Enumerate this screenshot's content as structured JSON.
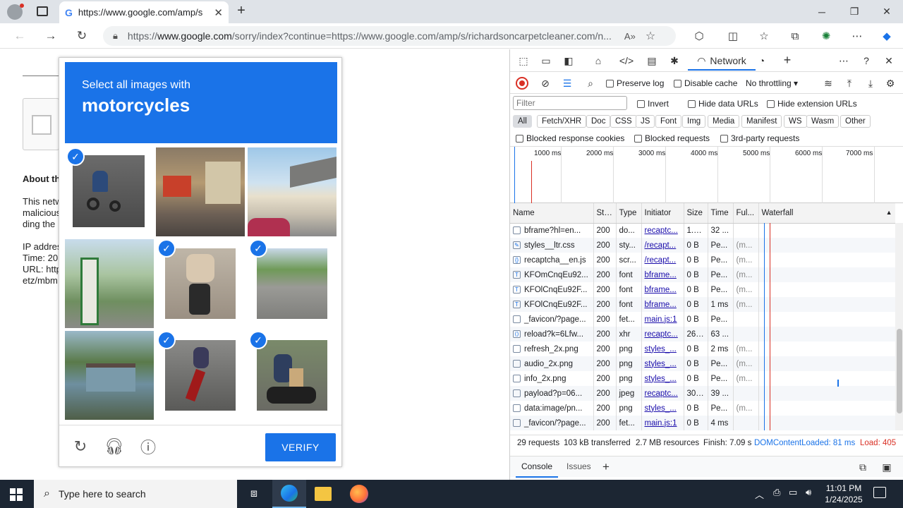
{
  "browser": {
    "tab_title": "https://www.google.com/amp/s",
    "url_prefix": "https://",
    "url_domain": "www.google.com",
    "url_rest": "/sorry/index?continue=https://www.google.com/amp/s/richardsoncarpetcleaner.com/n..."
  },
  "page": {
    "about_heading": "About th",
    "lines": [
      "This netw",
      "malicious",
      "ding the ",
      "",
      "IP addres",
      "Time: 20:",
      "URL: http",
      "etz/mbm"
    ]
  },
  "captcha": {
    "line1": "Select all images with",
    "line2": "motorcycles",
    "verify_label": "VERIFY",
    "check_glyph": "✓",
    "tiles": [
      {
        "selected": true,
        "scene": "motorcycle"
      },
      {
        "selected": false,
        "scene": "street"
      },
      {
        "selected": false,
        "scene": "overpass"
      },
      {
        "selected": false,
        "scene": "monument"
      },
      {
        "selected": true,
        "scene": "motorcycle"
      },
      {
        "selected": true,
        "scene": "road"
      },
      {
        "selected": false,
        "scene": "house"
      },
      {
        "selected": true,
        "scene": "motorcycle"
      },
      {
        "selected": true,
        "scene": "motorcycle"
      }
    ]
  },
  "devtools": {
    "tabs": {
      "network": "Network"
    },
    "preserve_log": "Preserve log",
    "disable_cache": "Disable cache",
    "throttling": "No throttling",
    "filter_placeholder": "Filter",
    "invert": "Invert",
    "hide_data_urls": "Hide data URLs",
    "hide_extension_urls": "Hide extension URLs",
    "type_filters": [
      "All",
      "Fetch/XHR",
      "Doc",
      "CSS",
      "JS",
      "Font",
      "Img",
      "Media",
      "Manifest",
      "WS",
      "Wasm",
      "Other"
    ],
    "blocked_response_cookies": "Blocked response cookies",
    "blocked_requests": "Blocked requests",
    "third_party": "3rd-party requests",
    "timeline_ticks": [
      "1000 ms",
      "2000 ms",
      "3000 ms",
      "4000 ms",
      "5000 ms",
      "6000 ms",
      "7000 ms"
    ],
    "columns": [
      "Name",
      "Sta...",
      "Type",
      "Initiator",
      "Size",
      "Time",
      "Ful...",
      "Waterfall"
    ],
    "rows": [
      [
        "bframe?hl=en...",
        "200",
        "do...",
        "recaptc...",
        "1.3...",
        "32 ...",
        ""
      ],
      [
        "styles__ltr.css",
        "200",
        "sty...",
        "/recapt...",
        "0 B",
        "Pe...",
        "(m..."
      ],
      [
        "recaptcha__en.js",
        "200",
        "scr...",
        "/recapt...",
        "0 B",
        "Pe...",
        "(m..."
      ],
      [
        "KFOmCnqEu92...",
        "200",
        "font",
        "bframe...",
        "0 B",
        "Pe...",
        "(m..."
      ],
      [
        "KFOlCnqEu92F...",
        "200",
        "font",
        "bframe...",
        "0 B",
        "Pe...",
        "(m..."
      ],
      [
        "KFOlCnqEu92F...",
        "200",
        "font",
        "bframe...",
        "0 B",
        "1 ms",
        "(m..."
      ],
      [
        "_favicon/?page...",
        "200",
        "fet...",
        "main.js:1",
        "0 B",
        "Pe...",
        ""
      ],
      [
        "reload?k=6Lfw...",
        "200",
        "xhr",
        "recaptc...",
        "26....",
        "63 ...",
        ""
      ],
      [
        "refresh_2x.png",
        "200",
        "png",
        "styles_...",
        "0 B",
        "2 ms",
        "(m..."
      ],
      [
        "audio_2x.png",
        "200",
        "png",
        "styles_...",
        "0 B",
        "Pe...",
        "(m..."
      ],
      [
        "info_2x.png",
        "200",
        "png",
        "styles_...",
        "0 B",
        "Pe...",
        "(m..."
      ],
      [
        "payload?p=06...",
        "200",
        "jpeg",
        "recaptc...",
        "30....",
        "39 ...",
        ""
      ],
      [
        "data:image/pn...",
        "200",
        "png",
        "styles_...",
        "0 B",
        "Pe...",
        "(m..."
      ],
      [
        "_favicon/?page...",
        "200",
        "fet...",
        "main.js:1",
        "0 B",
        "4 ms",
        ""
      ]
    ],
    "status": {
      "requests": "29 requests",
      "transferred": "103 kB transferred",
      "resources": "2.7 MB resources",
      "finish": "Finish: 7.09 s",
      "dcl": "DOMContentLoaded: 81 ms",
      "load": "Load: 405"
    },
    "drawer_tabs": [
      "Console",
      "Issues"
    ]
  },
  "taskbar": {
    "search_placeholder": "Type here to search",
    "time": "11:01 PM",
    "date": "1/24/2025"
  },
  "colors": {
    "accent": "#1a73e8",
    "taskbar": "#1c2633"
  }
}
